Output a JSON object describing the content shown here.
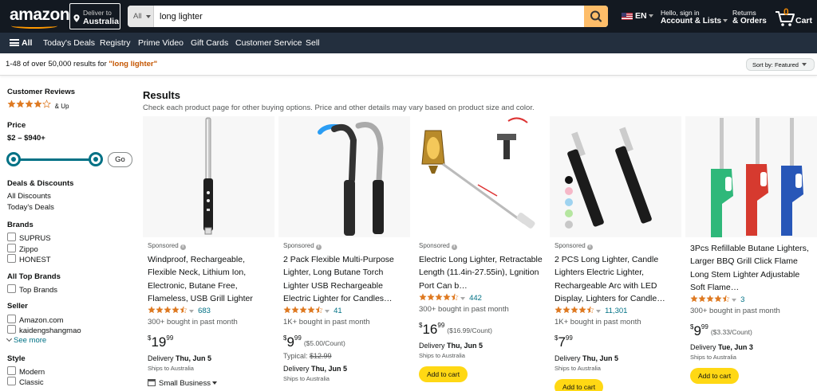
{
  "header": {
    "logo": "amazon",
    "deliver_label": "Deliver to",
    "deliver_location": "Australia",
    "search_category": "All",
    "search_value": "long lighter",
    "language": "EN",
    "account_line1": "Hello, sign in",
    "account_line2": "Account & Lists",
    "returns_line1": "Returns",
    "returns_line2": "& Orders",
    "cart_count": "0",
    "cart_label": "Cart"
  },
  "subnav": {
    "all_label": "All",
    "items": [
      "Today's Deals",
      "Registry",
      "Prime Video",
      "Gift Cards",
      "Customer Service",
      "Sell"
    ]
  },
  "results_bar": {
    "count_text": "1-48 of over 50,000 results for ",
    "query_text": "\"long lighter\"",
    "sort_label": "Sort by:",
    "sort_value": "Featured"
  },
  "sidebar": {
    "reviews_heading": "Customer Reviews",
    "reviews_up": "& Up",
    "price_heading": "Price",
    "price_range": "$2 – $940+",
    "go_label": "Go",
    "deals_heading": "Deals & Discounts",
    "deals_items": [
      "All Discounts",
      "Today's Deals"
    ],
    "brands_heading": "Brands",
    "brands": [
      "SUPRUS",
      "Zippo",
      "HONEST"
    ],
    "top_brands_heading": "All Top Brands",
    "top_brands_item": "Top Brands",
    "seller_heading": "Seller",
    "sellers": [
      "Amazon.com",
      "kaidengshangmao"
    ],
    "see_more": "See more",
    "style_heading": "Style",
    "styles": [
      "Modern",
      "Classic"
    ]
  },
  "results": {
    "heading": "Results",
    "subheading": "Check each product page for other buying options. Price and other details may vary based on product size and color.",
    "sponsored_label": "Sponsored",
    "delivery_label": "Delivery",
    "ships_label": "Ships to Australia",
    "add_to_cart": "Add to cart",
    "small_business": "Small Business",
    "products": [
      {
        "title": "Windproof, Rechargeable, Flexible Neck, Lithium Ion, Electronic, Butane Free, Flameless, USB Grill Lighter",
        "rating": 4.5,
        "reviews": "683",
        "bought": "300+ bought in past month",
        "price_whole": "19",
        "price_frac": "99",
        "unit_price": "",
        "typical": "",
        "delivery_date": "Thu, Jun 5"
      },
      {
        "title": "2 Pack Flexible Multi-Purpose Lighter, Long Butane Torch Lighter USB Rechargeable Electric Lighter for Candles…",
        "rating": 4.5,
        "reviews": "41",
        "bought": "1K+ bought in past month",
        "price_whole": "9",
        "price_frac": "99",
        "unit_price": "($5.00/Count)",
        "typical_label": "Typical:",
        "typical": "$12.99",
        "delivery_date": "Thu, Jun 5"
      },
      {
        "title": "Electric Long Lighter, Retractable Length (11.4in-27.55in), Lgnition Port Can b…",
        "rating": 4.5,
        "reviews": "442",
        "bought": "300+ bought in past month",
        "price_whole": "16",
        "price_frac": "99",
        "unit_price": "($16.99/Count)",
        "typical": "",
        "delivery_date": "Thu, Jun 5"
      },
      {
        "title": "2 PCS Long Lighter, Candle Lighters Electric Lighter, Rechargeable Arc with LED Display, Lighters for Candle…",
        "rating": 4.5,
        "reviews": "11,301",
        "bought": "1K+ bought in past month",
        "price_whole": "7",
        "price_frac": "99",
        "unit_price": "",
        "typical": "",
        "delivery_date": "Thu, Jun 5"
      },
      {
        "title": "3Pcs Refillable Butane Lighters, Larger BBQ Grill Click Flame Long Stem Lighter Adjustable Soft Flame…",
        "rating": 4.5,
        "reviews": "3",
        "bought": "300+ bought in past month",
        "price_whole": "9",
        "price_frac": "99",
        "unit_price": "($3.33/Count)",
        "typical": "",
        "delivery_date": "Tue, Jun 3"
      }
    ]
  },
  "colors": {
    "nav_dark": "#131921",
    "nav_sub": "#232f3e",
    "accent": "#ff9900",
    "star": "#de7921",
    "link": "#007185",
    "button_yellow": "#ffd814"
  }
}
